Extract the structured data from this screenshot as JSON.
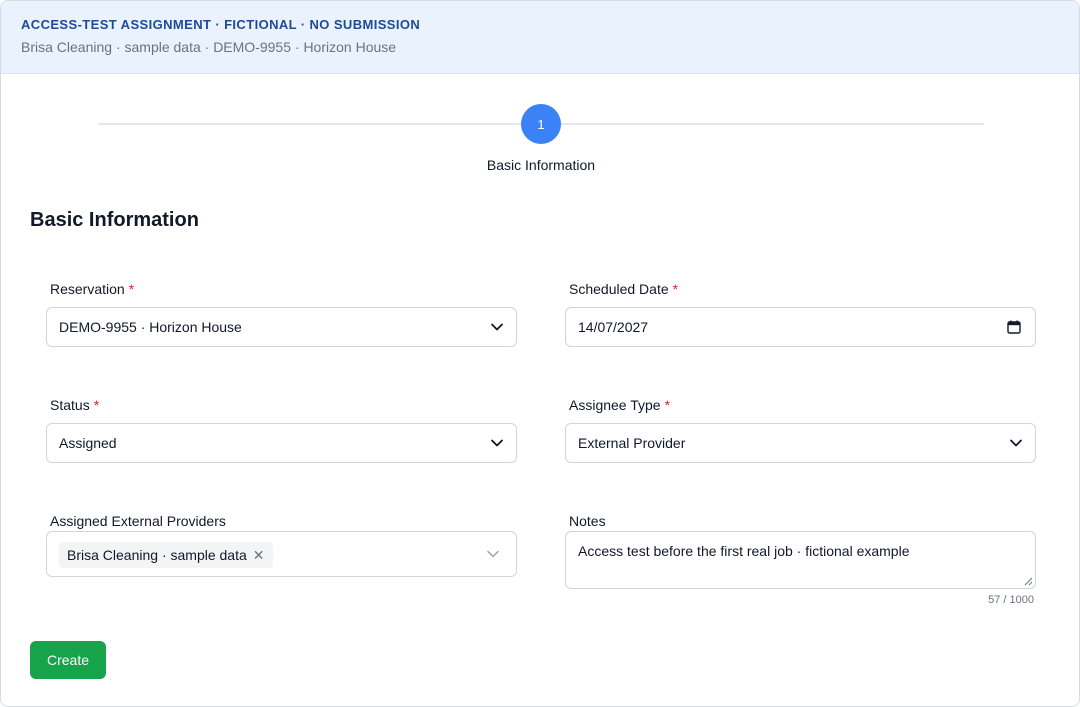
{
  "banner": {
    "title": "ACCESS-TEST ASSIGNMENT · FICTIONAL · NO SUBMISSION",
    "subtitle": "Brisa Cleaning · sample data · DEMO-9955 · Horizon House"
  },
  "stepper": {
    "steps": [
      {
        "number": "1",
        "label": "Basic Information",
        "active": true
      }
    ]
  },
  "section": {
    "title": "Basic Information"
  },
  "fields": {
    "reservation": {
      "label": "Reservation",
      "required_mark": "*",
      "value": "DEMO-9955 · Horizon House"
    },
    "scheduled_date": {
      "label": "Scheduled Date",
      "required_mark": "*",
      "value": "14/07/2027"
    },
    "status": {
      "label": "Status",
      "required_mark": "*",
      "value": "Assigned"
    },
    "assignee_type": {
      "label": "Assignee Type",
      "required_mark": "*",
      "value": "External Provider"
    },
    "assigned_external_providers": {
      "label": "Assigned External Providers",
      "chips": [
        {
          "label": "Brisa Cleaning · sample data",
          "remove_glyph": "✕"
        }
      ]
    },
    "notes": {
      "label": "Notes",
      "value": "Access test before the first real job · fictional example",
      "counter": "57 / 1000"
    }
  },
  "actions": {
    "create_label": "Create"
  },
  "colors": {
    "banner_bg": "#eaf3fd",
    "banner_title": "#1e4a9a",
    "step_active": "#3b82f6",
    "required": "#dc2626",
    "primary_button": "#16a34a"
  },
  "icons": {
    "select_arrow": "chevron-down-icon",
    "date_picker": "calendar-icon",
    "chip_remove": "close-icon"
  }
}
